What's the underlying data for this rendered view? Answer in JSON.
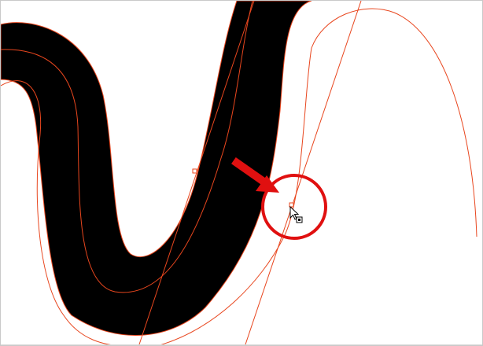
{
  "canvas": {
    "background_color": "#ffffff",
    "stroke_fill_color": "#000000",
    "path_outline_color": "#e8461e",
    "annotation_color": "#e01010",
    "control_point_fill": "#ffffff"
  },
  "icons": {
    "pointer": "selection-cursor-icon",
    "annotation": "red-arrow-icon",
    "highlight": "red-circle-highlight-icon"
  }
}
